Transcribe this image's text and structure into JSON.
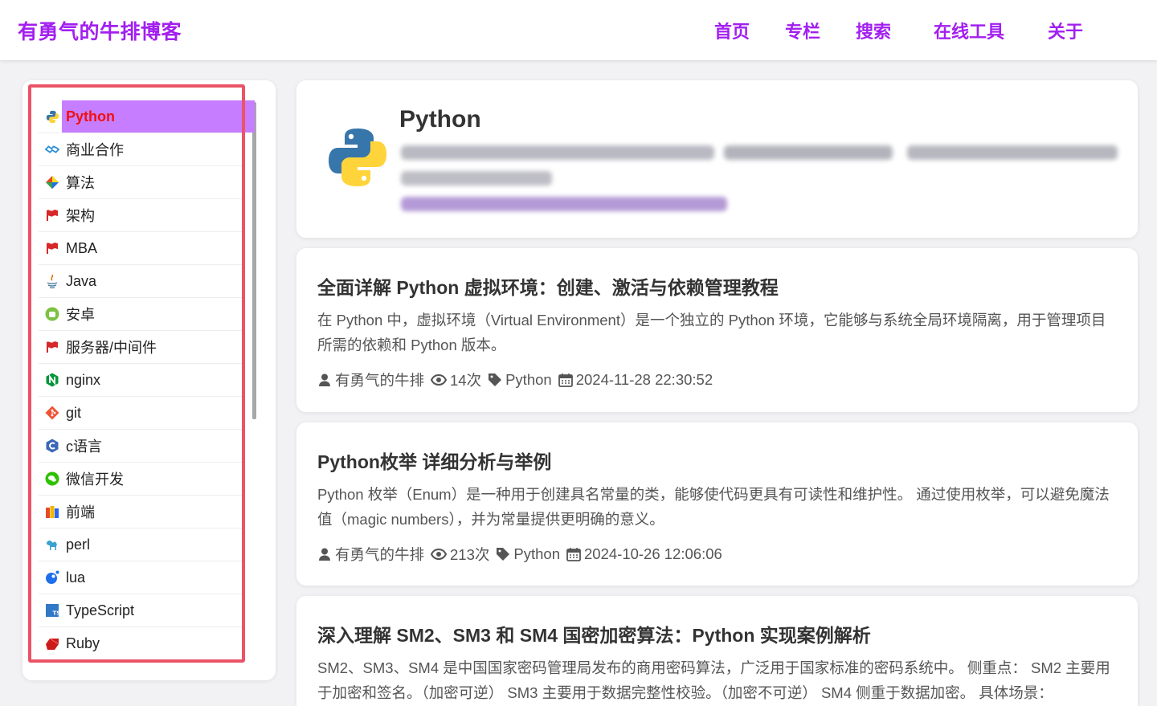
{
  "header": {
    "site_title": "有勇气的牛排博客",
    "nav": [
      {
        "label": "首页"
      },
      {
        "label": "专栏"
      },
      {
        "label": "搜索"
      },
      {
        "label": "在线工具"
      },
      {
        "label": "关于"
      }
    ]
  },
  "sidebar": {
    "items": [
      {
        "label": "Python",
        "icon": "python-icon",
        "active": true
      },
      {
        "label": "商业合作",
        "icon": "handshake-icon"
      },
      {
        "label": "算法",
        "icon": "cube-icon"
      },
      {
        "label": "架构",
        "icon": "flag-icon"
      },
      {
        "label": "MBA",
        "icon": "flag-icon"
      },
      {
        "label": "Java",
        "icon": "java-icon"
      },
      {
        "label": "安卓",
        "icon": "android-icon"
      },
      {
        "label": "服务器/中间件",
        "icon": "flag-icon"
      },
      {
        "label": "nginx",
        "icon": "nginx-icon"
      },
      {
        "label": "git",
        "icon": "git-icon"
      },
      {
        "label": "c语言",
        "icon": "c-icon"
      },
      {
        "label": "微信开发",
        "icon": "wechat-icon"
      },
      {
        "label": "前端",
        "icon": "frontend-icon"
      },
      {
        "label": "perl",
        "icon": "camel-icon"
      },
      {
        "label": "lua",
        "icon": "lua-icon"
      },
      {
        "label": "TypeScript",
        "icon": "typescript-icon"
      },
      {
        "label": "Ruby",
        "icon": "ruby-icon"
      }
    ]
  },
  "topic": {
    "title": "Python"
  },
  "posts": [
    {
      "title": "全面详解 Python 虚拟环境：创建、激活与依赖管理教程",
      "excerpt": "在 Python 中，虚拟环境（Virtual Environment）是一个独立的 Python 环境，它能够与系统全局环境隔离，用于管理项目所需的依赖和 Python 版本。",
      "author": "有勇气的牛排",
      "views": "14次",
      "tag": "Python",
      "date": "2024-11-28 22:30:52"
    },
    {
      "title": "Python枚举 详细分析与举例",
      "excerpt": "Python 枚举（Enum）是一种用于创建具名常量的类，能够使代码更具有可读性和维护性。 通过使用枚举，可以避免魔法值（magic numbers），并为常量提供更明确的意义。",
      "author": "有勇气的牛排",
      "views": "213次",
      "tag": "Python",
      "date": "2024-10-26 12:06:06"
    },
    {
      "title": "深入理解 SM2、SM3 和 SM4 国密加密算法：Python 实现案例解析",
      "excerpt": "SM2、SM3、SM4 是中国国家密码管理局发布的商用密码算法，广泛用于国家标准的密码系统中。 侧重点： SM2 主要用于加密和签名。（加密可逆） SM3 主要用于数据完整性校验。（加密不可逆） SM4 侧重于数据加密。 具体场景："
    }
  ],
  "colors": {
    "brand": "#a21ff0",
    "active_bg": "#c77dff",
    "active_text": "#f01010",
    "highlight_border": "#ea5466"
  }
}
